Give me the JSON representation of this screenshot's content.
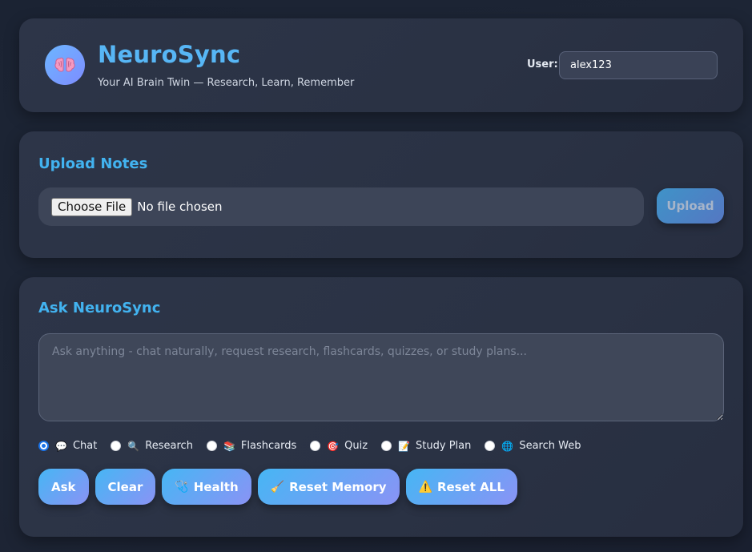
{
  "header": {
    "logo_icon": "brain-icon",
    "title": "NeuroSync",
    "subtitle": "Your AI Brain Twin — Research, Learn, Remember",
    "user_label": "User:",
    "user_value": "alex123"
  },
  "upload": {
    "title": "Upload Notes",
    "choose_label": "Choose File",
    "file_status": "No file chosen",
    "upload_label": "Upload"
  },
  "ask": {
    "title": "Ask NeuroSync",
    "placeholder": "Ask anything - chat naturally, request research, flashcards, quizzes, or study plans...",
    "modes": [
      {
        "label": "Chat",
        "icon": "💬",
        "checked": true
      },
      {
        "label": "Research",
        "icon": "🔍",
        "checked": false
      },
      {
        "label": "Flashcards",
        "icon": "📚",
        "checked": false
      },
      {
        "label": "Quiz",
        "icon": "🎯",
        "checked": false
      },
      {
        "label": "Study Plan",
        "icon": "📝",
        "checked": false
      },
      {
        "label": "Search Web",
        "icon": "🌐",
        "checked": false
      }
    ],
    "buttons": {
      "ask": "Ask",
      "clear": "Clear",
      "health": "Health",
      "reset_memory": "Reset Memory",
      "reset_all": "Reset ALL"
    },
    "button_icons": {
      "health": "🩺",
      "reset_memory": "🧹",
      "reset_all": "⚠️"
    }
  },
  "colors": {
    "accent": "#42b3f0",
    "button_gradient_start": "#46b6f4",
    "button_gradient_end": "#8a93f5",
    "card_bg": "#2d3548",
    "page_bg": "#1b2333"
  }
}
